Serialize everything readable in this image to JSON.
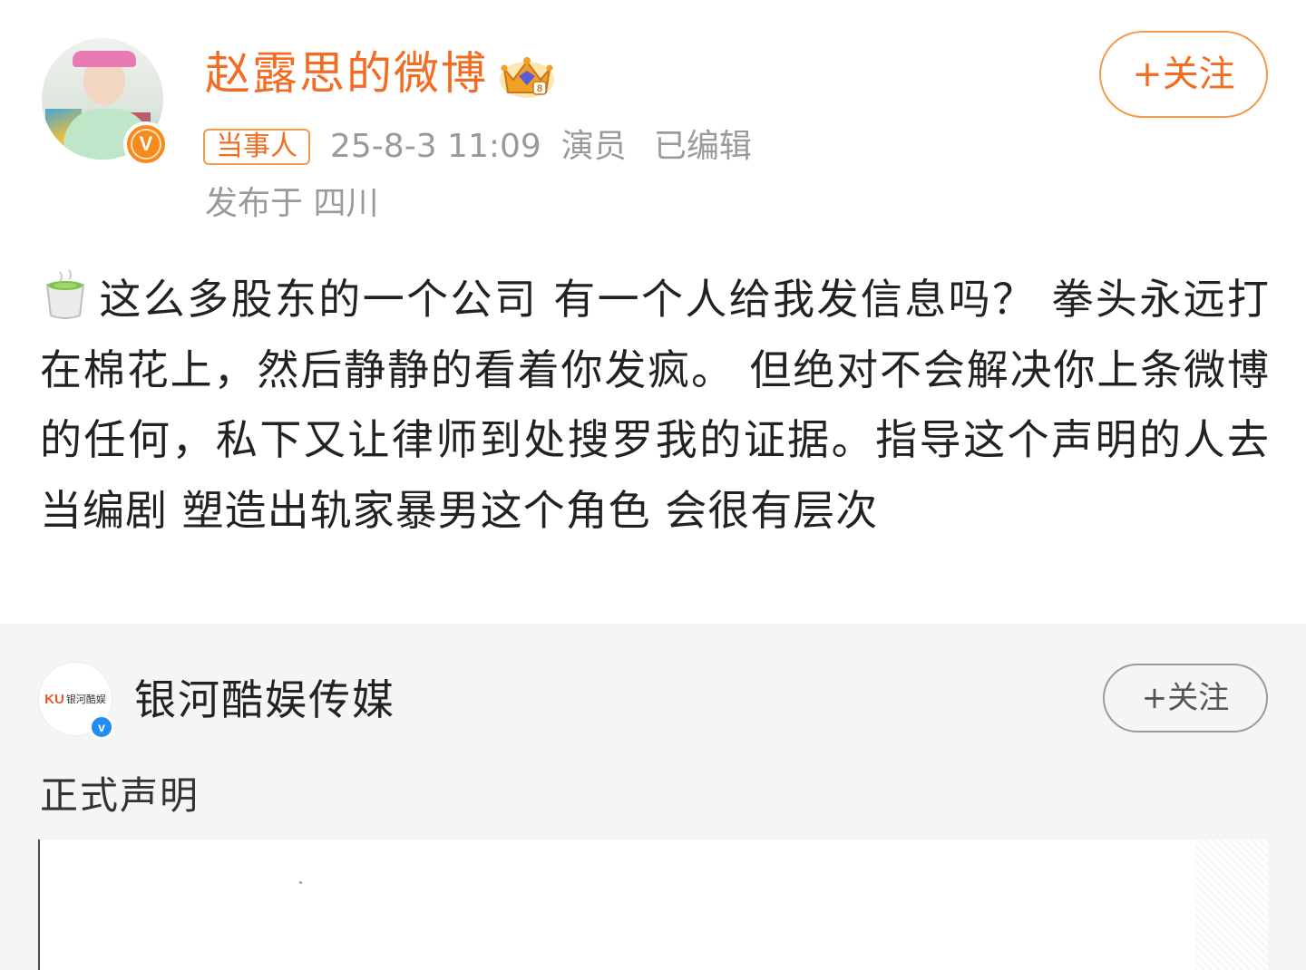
{
  "post": {
    "username": "赵露思的微博",
    "follow_label": "+关注",
    "tag": "当事人",
    "timestamp": "25-8-3 11:09",
    "role": "演员",
    "edited": "已编辑",
    "location": "发布于 四川",
    "text": "这么多股东的一个公司 有一个人给我发信息吗？ 拳头永远打在棉花上，然后静静的看着你发疯。 但绝对不会解决你上条微博的任何，私下又让律师到处搜罗我的证据。指导这个声明的人去当编剧 塑造出轨家暴男这个角色 会很有层次"
  },
  "repost": {
    "account_name": "银河酷娱传媒",
    "avatar_logo": "KU",
    "avatar_logo_sub": "银河酷娱",
    "follow_label": "+关注",
    "text": "正式声明"
  },
  "colors": {
    "accent_orange": "#f26d22",
    "meta_gray": "#9a9a9a",
    "verified_blue": "#1f8df1"
  }
}
